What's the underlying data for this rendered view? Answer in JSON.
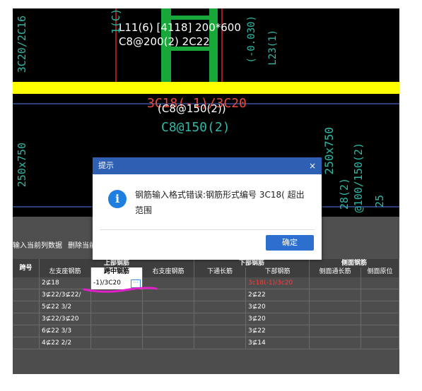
{
  "cad": {
    "beam_label_line1": "L11(6) [4118] 200*600",
    "beam_label_line2": "C8@200(2) 2C22",
    "left_vertical_1": "3C20/2C16",
    "left_vertical_2": "250x750",
    "col_vertical_1": "1(C)",
    "mid_vertical": "(-0.030)",
    "mid_vertical_2": "L23(1)",
    "red_annotation": "3C18(-1)/3C20",
    "white_annotation": "(C8@150(2))",
    "cyan_annotation": "C8@150(2)",
    "right_vertical_1": "250x750",
    "right_vertical_2": "28(2)",
    "right_vertical_3": "@100/150(2)",
    "right_vertical_4": "25"
  },
  "toolbar": {
    "input_current_column": "输入当前列数据",
    "delete_current": "删除当前"
  },
  "dialog": {
    "title": "提示",
    "close": "×",
    "message": "钢筋输入格式错误:钢筋形式编号 3C18( 超出范围",
    "ok": "确定"
  },
  "table": {
    "group_headers": {
      "span_no": "跨号",
      "top_rebar": "上部钢筋",
      "bottom_rebar": "下部钢筋",
      "side_rebar": "侧面钢筋"
    },
    "sub_headers": [
      "左支座钢筋",
      "跨中钢筋",
      "右支座钢筋",
      "下通长筋",
      "下部钢筋",
      "侧面通长筋",
      "侧面原位"
    ],
    "rows": [
      {
        "left": "2⊈18",
        "mid": "-1)/3C20",
        "right": "",
        "bottom_through": "",
        "bottom": "3c18(-1)/3c20",
        "side_through": "",
        "side_local": ""
      },
      {
        "left": "3⊈22/3⊈22/",
        "mid": "",
        "right": "",
        "bottom_through": "",
        "bottom": "2⊈22",
        "side_through": "",
        "side_local": ""
      },
      {
        "left": "5⊈22 3/2",
        "mid": "",
        "right": "",
        "bottom_through": "",
        "bottom": "3⊈20",
        "side_through": "",
        "side_local": ""
      },
      {
        "left": "3⊈22/3⊈20",
        "mid": "",
        "right": "",
        "bottom_through": "",
        "bottom": "3⊈20",
        "side_through": "",
        "side_local": ""
      },
      {
        "left": "6⊈22 3/3",
        "mid": "",
        "right": "",
        "bottom_through": "",
        "bottom": "3⊈22",
        "side_through": "",
        "side_local": ""
      },
      {
        "left": "4⊈22 2/2",
        "mid": "",
        "right": "",
        "bottom_through": "",
        "bottom": "3⊈14",
        "side_through": "",
        "side_local": ""
      }
    ],
    "edit_button": "···"
  },
  "colors": {
    "dialog_title_bar": "#2d5fb3",
    "ok_button": "#2d6fcf",
    "error_text": "#ff3a3a",
    "yellow_beam": "#ffff00",
    "green_column": "#18a83a"
  }
}
